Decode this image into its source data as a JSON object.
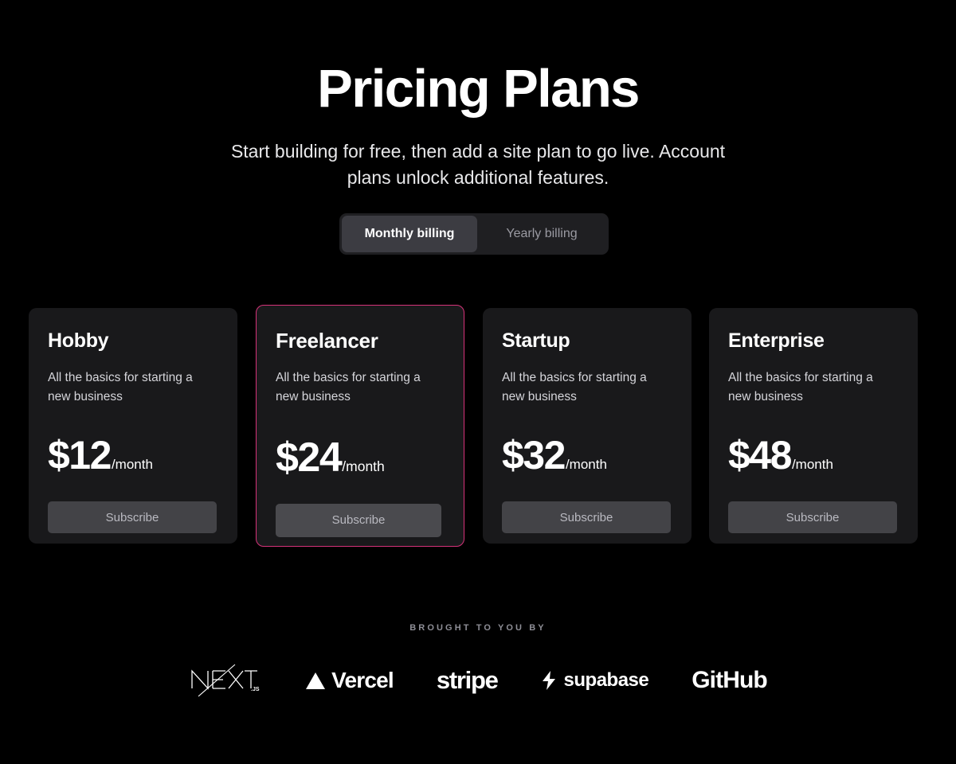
{
  "header": {
    "title": "Pricing Plans",
    "subtitle": "Start building for free, then add a site plan to go live. Account plans unlock additional features."
  },
  "billing_toggle": {
    "monthly_label": "Monthly billing",
    "yearly_label": "Yearly billing",
    "selected": "Monthly billing"
  },
  "plans": [
    {
      "name": "Hobby",
      "description": "All the basics for starting a new business",
      "price": "$12",
      "period": "/month",
      "cta": "Subscribe",
      "featured": false
    },
    {
      "name": "Freelancer",
      "description": "All the basics for starting a new business",
      "price": "$24",
      "period": "/month",
      "cta": "Subscribe",
      "featured": true
    },
    {
      "name": "Startup",
      "description": "All the basics for starting a new business",
      "price": "$32",
      "period": "/month",
      "cta": "Subscribe",
      "featured": false
    },
    {
      "name": "Enterprise",
      "description": "All the basics for starting a new business",
      "price": "$48",
      "period": "/month",
      "cta": "Subscribe",
      "featured": false
    }
  ],
  "footer": {
    "label": "BROUGHT TO YOU BY",
    "logos": [
      {
        "icon": "nextjs-logo-icon",
        "name": "NEXT",
        "suffix": ".JS"
      },
      {
        "icon": "vercel-triangle-icon",
        "name": "Vercel"
      },
      {
        "icon": "stripe-wordmark-icon",
        "name": "stripe"
      },
      {
        "icon": "supabase-bolt-icon",
        "name": "supabase"
      },
      {
        "icon": "github-wordmark-icon",
        "name": "GitHub"
      }
    ]
  },
  "colors": {
    "background": "#000000",
    "card_background": "#19191b",
    "featured_border": "#d6337a",
    "button_background": "#434347",
    "toggle_track": "#1f1f22",
    "toggle_active": "#3c3c42"
  }
}
